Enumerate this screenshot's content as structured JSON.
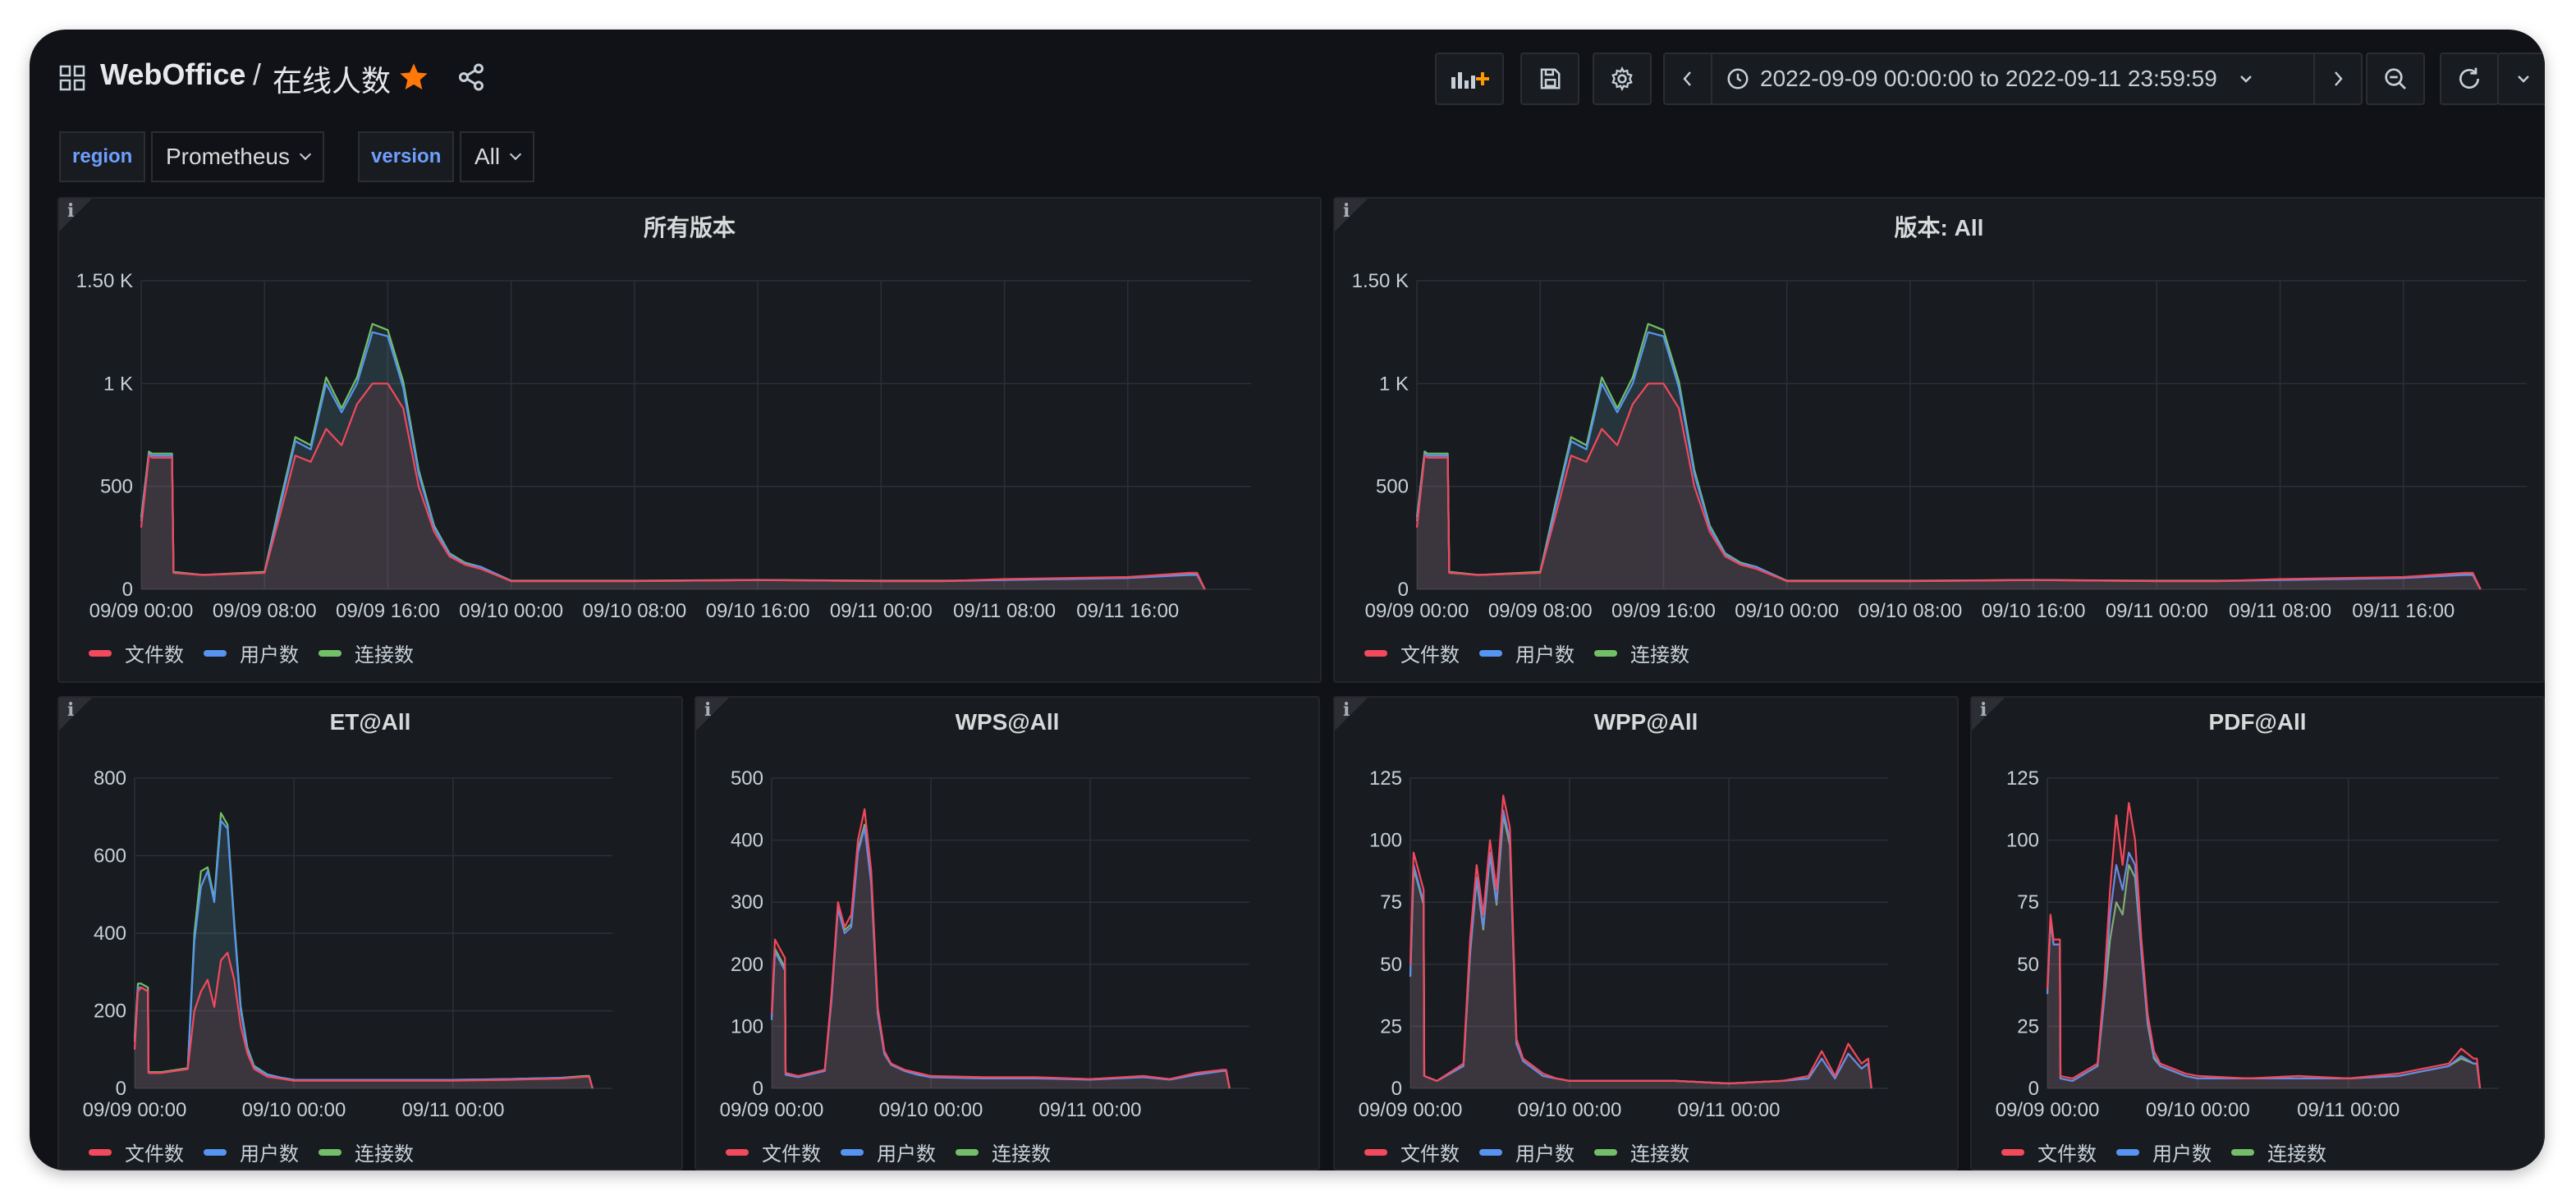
{
  "colors": {
    "file": "#f2495c",
    "user": "#5794f2",
    "conn": "#73bf69",
    "star": "#ff780a",
    "variable": "#6e9fff"
  },
  "header": {
    "brand": "WebOffice",
    "separator": "/",
    "dashboard_title": "在线人数",
    "time_range": "2022-09-09 00:00:00 to 2022-09-11 23:59:59"
  },
  "variables": [
    {
      "label": "region",
      "value": "Prometheus"
    },
    {
      "label": "version",
      "value": "All"
    }
  ],
  "panels": [
    {
      "title": "所有版本",
      "legend": [
        "文件数",
        "用户数",
        "连接数"
      ]
    },
    {
      "title": "版本: All",
      "legend": [
        "文件数",
        "用户数",
        "连接数"
      ]
    },
    {
      "title": "ET@All",
      "legend": [
        "文件数",
        "用户数",
        "连接数"
      ]
    },
    {
      "title": "WPS@All",
      "legend": [
        "文件数",
        "用户数",
        "连接数"
      ]
    },
    {
      "title": "WPP@All",
      "legend": [
        "文件数",
        "用户数",
        "连接数"
      ]
    },
    {
      "title": "PDF@All",
      "legend": [
        "文件数",
        "用户数",
        "连接数"
      ]
    }
  ],
  "chart_data": [
    {
      "type": "area",
      "title": "所有版本",
      "ylim": [
        0,
        1500
      ],
      "yticks": [
        0,
        500,
        1000,
        1500
      ],
      "ytick_labels": [
        "0",
        "500",
        "1 K",
        "1.50 K"
      ],
      "xlim": [
        0,
        72
      ],
      "xticks": [
        0,
        8,
        16,
        24,
        32,
        40,
        48,
        56,
        64
      ],
      "xtick_labels": [
        "09/09 00:00",
        "09/09 08:00",
        "09/09 16:00",
        "09/10 00:00",
        "09/10 08:00",
        "09/10 16:00",
        "09/11 00:00",
        "09/11 08:00",
        "09/11 16:00"
      ],
      "x": [
        0,
        0.5,
        0.7,
        2,
        2.1,
        4,
        8,
        9,
        10,
        11,
        12,
        13,
        14,
        15,
        16,
        17,
        18,
        19,
        20,
        21,
        22,
        24,
        26,
        27,
        32,
        40,
        48,
        52,
        56,
        60,
        64,
        68,
        68.5,
        69
      ],
      "series": [
        {
          "name": "文件数",
          "values": [
            300,
            650,
            640,
            640,
            80,
            70,
            80,
            360,
            650,
            620,
            780,
            700,
            900,
            1000,
            1000,
            880,
            500,
            280,
            160,
            120,
            100,
            40,
            40,
            40,
            40,
            45,
            40,
            40,
            50,
            55,
            60,
            80,
            80,
            0
          ]
        },
        {
          "name": "用户数",
          "values": [
            330,
            660,
            650,
            650,
            80,
            70,
            80,
            400,
            720,
            680,
            1000,
            860,
            1000,
            1250,
            1230,
            980,
            560,
            300,
            170,
            125,
            110,
            40,
            40,
            40,
            40,
            45,
            40,
            40,
            45,
            50,
            55,
            70,
            70,
            0
          ]
        },
        {
          "name": "连接数",
          "values": [
            350,
            670,
            660,
            660,
            85,
            70,
            85,
            420,
            740,
            700,
            1030,
            880,
            1030,
            1290,
            1260,
            1010,
            580,
            310,
            175,
            130,
            110,
            42,
            42,
            42,
            42,
            46,
            42,
            42,
            46,
            52,
            56,
            72,
            72,
            0
          ]
        }
      ]
    },
    {
      "type": "area",
      "title": "版本: All",
      "ylim": [
        0,
        1500
      ],
      "yticks": [
        0,
        500,
        1000,
        1500
      ],
      "ytick_labels": [
        "0",
        "500",
        "1 K",
        "1.50 K"
      ],
      "xlim": [
        0,
        72
      ],
      "xticks": [
        0,
        8,
        16,
        24,
        32,
        40,
        48,
        56,
        64
      ],
      "xtick_labels": [
        "09/09 00:00",
        "09/09 08:00",
        "09/09 16:00",
        "09/10 00:00",
        "09/10 08:00",
        "09/10 16:00",
        "09/11 00:00",
        "09/11 08:00",
        "09/11 16:00"
      ],
      "x": [
        0,
        0.5,
        0.7,
        2,
        2.1,
        4,
        8,
        9,
        10,
        11,
        12,
        13,
        14,
        15,
        16,
        17,
        18,
        19,
        20,
        21,
        22,
        24,
        26,
        27,
        32,
        40,
        48,
        52,
        56,
        60,
        64,
        68,
        68.5,
        69
      ],
      "series": [
        {
          "name": "文件数",
          "values": [
            300,
            650,
            640,
            640,
            80,
            70,
            80,
            360,
            650,
            620,
            780,
            700,
            900,
            1000,
            1000,
            880,
            500,
            280,
            160,
            120,
            100,
            40,
            40,
            40,
            40,
            45,
            40,
            40,
            50,
            55,
            60,
            80,
            80,
            0
          ]
        },
        {
          "name": "用户数",
          "values": [
            330,
            660,
            650,
            650,
            80,
            70,
            80,
            400,
            720,
            680,
            1000,
            860,
            1000,
            1250,
            1230,
            980,
            560,
            300,
            170,
            125,
            110,
            40,
            40,
            40,
            40,
            45,
            40,
            40,
            45,
            50,
            55,
            70,
            70,
            0
          ]
        },
        {
          "name": "连接数",
          "values": [
            350,
            670,
            660,
            660,
            85,
            70,
            85,
            420,
            740,
            700,
            1030,
            880,
            1030,
            1290,
            1260,
            1010,
            580,
            310,
            175,
            130,
            110,
            42,
            42,
            42,
            42,
            46,
            42,
            42,
            46,
            52,
            56,
            72,
            72,
            0
          ]
        }
      ]
    },
    {
      "type": "area",
      "title": "ET@All",
      "ylim": [
        0,
        800
      ],
      "yticks": [
        0,
        200,
        400,
        600,
        800
      ],
      "ytick_labels": [
        "0",
        "200",
        "400",
        "600",
        "800"
      ],
      "xlim": [
        0,
        72
      ],
      "xticks": [
        0,
        24,
        48
      ],
      "xtick_labels": [
        "09/09 00:00",
        "09/10 00:00",
        "09/11 00:00"
      ],
      "x": [
        0,
        0.5,
        1,
        2,
        2.1,
        4,
        8,
        9,
        10,
        11,
        12,
        13,
        14,
        15,
        16,
        17,
        18,
        20,
        22,
        24,
        32,
        40,
        48,
        56,
        64,
        68,
        68.5,
        69
      ],
      "series": [
        {
          "name": "文件数",
          "values": [
            100,
            250,
            260,
            250,
            40,
            40,
            50,
            200,
            250,
            280,
            210,
            330,
            350,
            280,
            160,
            90,
            50,
            30,
            25,
            20,
            20,
            20,
            20,
            22,
            25,
            30,
            30,
            0
          ]
        },
        {
          "name": "用户数",
          "values": [
            120,
            260,
            260,
            250,
            40,
            40,
            50,
            380,
            520,
            560,
            480,
            690,
            670,
            420,
            200,
            100,
            55,
            35,
            28,
            22,
            22,
            22,
            22,
            24,
            27,
            30,
            30,
            0
          ]
        },
        {
          "name": "连接数",
          "values": [
            130,
            270,
            270,
            260,
            42,
            42,
            52,
            400,
            560,
            570,
            490,
            710,
            680,
            430,
            210,
            105,
            58,
            36,
            28,
            22,
            22,
            22,
            22,
            24,
            27,
            32,
            32,
            0
          ]
        }
      ]
    },
    {
      "type": "area",
      "title": "WPS@All",
      "ylim": [
        0,
        500
      ],
      "yticks": [
        0,
        100,
        200,
        300,
        400,
        500
      ],
      "ytick_labels": [
        "0",
        "100",
        "200",
        "300",
        "400",
        "500"
      ],
      "xlim": [
        0,
        72
      ],
      "xticks": [
        0,
        24,
        48
      ],
      "xtick_labels": [
        "09/09 00:00",
        "09/10 00:00",
        "09/11 00:00"
      ],
      "x": [
        0,
        0.5,
        1,
        2,
        2.1,
        4,
        8,
        9,
        10,
        11,
        12,
        13,
        14,
        15,
        16,
        17,
        18,
        20,
        22,
        24,
        32,
        40,
        48,
        56,
        60,
        64,
        68,
        68.5,
        69
      ],
      "series": [
        {
          "name": "文件数",
          "values": [
            120,
            240,
            230,
            210,
            25,
            20,
            30,
            150,
            300,
            260,
            280,
            400,
            450,
            350,
            130,
            60,
            40,
            30,
            25,
            20,
            18,
            18,
            15,
            20,
            15,
            25,
            30,
            30,
            0
          ]
        },
        {
          "name": "用户数",
          "values": [
            110,
            220,
            210,
            190,
            22,
            18,
            28,
            140,
            290,
            250,
            260,
            380,
            420,
            330,
            120,
            55,
            38,
            28,
            22,
            18,
            16,
            16,
            14,
            18,
            14,
            22,
            28,
            28,
            0
          ]
        },
        {
          "name": "连接数",
          "values": [
            115,
            225,
            215,
            195,
            23,
            19,
            29,
            145,
            295,
            255,
            265,
            385,
            425,
            335,
            122,
            56,
            39,
            29,
            23,
            19,
            17,
            17,
            15,
            19,
            15,
            23,
            29,
            29,
            0
          ]
        }
      ]
    },
    {
      "type": "area",
      "title": "WPP@All",
      "ylim": [
        0,
        125
      ],
      "yticks": [
        0,
        25,
        50,
        75,
        100,
        125
      ],
      "ytick_labels": [
        "0",
        "25",
        "50",
        "75",
        "100",
        "125"
      ],
      "xlim": [
        0,
        72
      ],
      "xticks": [
        0,
        24,
        48
      ],
      "xtick_labels": [
        "09/09 00:00",
        "09/10 00:00",
        "09/11 00:00"
      ],
      "x": [
        0,
        0.5,
        1,
        2,
        2.1,
        4,
        8,
        9,
        10,
        11,
        12,
        13,
        14,
        15,
        16,
        17,
        18,
        20,
        22,
        24,
        32,
        40,
        48,
        56,
        60,
        62,
        64,
        66,
        68,
        69,
        69.5
      ],
      "series": [
        {
          "name": "文件数",
          "values": [
            50,
            95,
            90,
            80,
            5,
            3,
            10,
            60,
            90,
            70,
            100,
            80,
            118,
            105,
            20,
            12,
            10,
            6,
            4,
            3,
            3,
            3,
            2,
            3,
            5,
            15,
            5,
            18,
            10,
            12,
            0
          ]
        },
        {
          "name": "用户数",
          "values": [
            45,
            90,
            85,
            75,
            5,
            3,
            9,
            55,
            85,
            65,
            95,
            75,
            112,
            100,
            18,
            11,
            9,
            5,
            4,
            3,
            3,
            3,
            2,
            3,
            4,
            12,
            4,
            14,
            8,
            10,
            0
          ]
        },
        {
          "name": "连接数",
          "values": [
            45,
            88,
            84,
            74,
            5,
            3,
            9,
            54,
            84,
            64,
            94,
            74,
            110,
            98,
            18,
            11,
            9,
            5,
            4,
            3,
            3,
            3,
            2,
            3,
            4,
            12,
            4,
            14,
            8,
            10,
            0
          ]
        }
      ]
    },
    {
      "type": "area",
      "title": "PDF@All",
      "ylim": [
        0,
        125
      ],
      "yticks": [
        0,
        25,
        50,
        75,
        100,
        125
      ],
      "ytick_labels": [
        "0",
        "25",
        "50",
        "75",
        "100",
        "125"
      ],
      "xlim": [
        0,
        72
      ],
      "xticks": [
        0,
        24,
        48
      ],
      "xtick_labels": [
        "09/09 00:00",
        "09/10 00:00",
        "09/11 00:00"
      ],
      "x": [
        0,
        0.5,
        1,
        2,
        2.1,
        4,
        8,
        9,
        10,
        11,
        12,
        13,
        14,
        15,
        16,
        17,
        18,
        20,
        22,
        24,
        32,
        40,
        48,
        56,
        60,
        64,
        66,
        68,
        68.5,
        69
      ],
      "series": [
        {
          "name": "文件数",
          "values": [
            40,
            70,
            60,
            60,
            5,
            4,
            10,
            40,
            80,
            110,
            90,
            115,
            100,
            60,
            30,
            15,
            10,
            8,
            6,
            5,
            4,
            5,
            4,
            6,
            8,
            10,
            16,
            12,
            12,
            0
          ]
        },
        {
          "name": "用户数",
          "values": [
            38,
            68,
            58,
            58,
            4,
            3,
            9,
            35,
            70,
            90,
            80,
            95,
            90,
            55,
            27,
            13,
            9,
            7,
            5,
            4,
            4,
            4,
            4,
            5,
            7,
            9,
            13,
            10,
            10,
            0
          ]
        },
        {
          "name": "连接数",
          "values": [
            38,
            68,
            58,
            58,
            4,
            3,
            9,
            34,
            60,
            75,
            70,
            90,
            85,
            55,
            26,
            12,
            9,
            7,
            5,
            4,
            4,
            4,
            4,
            5,
            7,
            9,
            12,
            10,
            10,
            0
          ]
        }
      ]
    }
  ]
}
